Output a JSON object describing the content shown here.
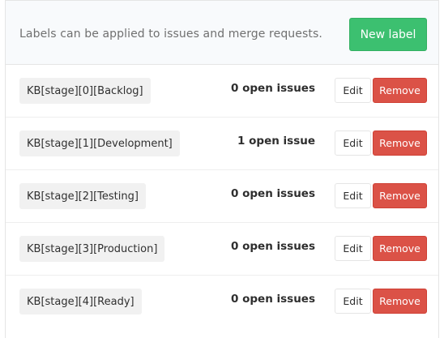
{
  "header": {
    "description": "Labels can be applied to issues and merge requests.",
    "new_label_button": "New label"
  },
  "labels": [
    {
      "name": "KB[stage][0][Backlog]",
      "count": "0 open issues",
      "edit": "Edit",
      "remove": "Remove"
    },
    {
      "name": "KB[stage][1][Development]",
      "count": "1 open issue",
      "edit": "Edit",
      "remove": "Remove"
    },
    {
      "name": "KB[stage][2][Testing]",
      "count": "0 open issues",
      "edit": "Edit",
      "remove": "Remove"
    },
    {
      "name": "KB[stage][3][Production]",
      "count": "0 open issues",
      "edit": "Edit",
      "remove": "Remove"
    },
    {
      "name": "KB[stage][4][Ready]",
      "count": "0 open issues",
      "edit": "Edit",
      "remove": "Remove"
    }
  ],
  "colors": {
    "new_label_bg": "#3cc070",
    "remove_bg": "#db5247",
    "header_bg": "#f8fafc",
    "chip_bg": "#f1f1f1"
  }
}
